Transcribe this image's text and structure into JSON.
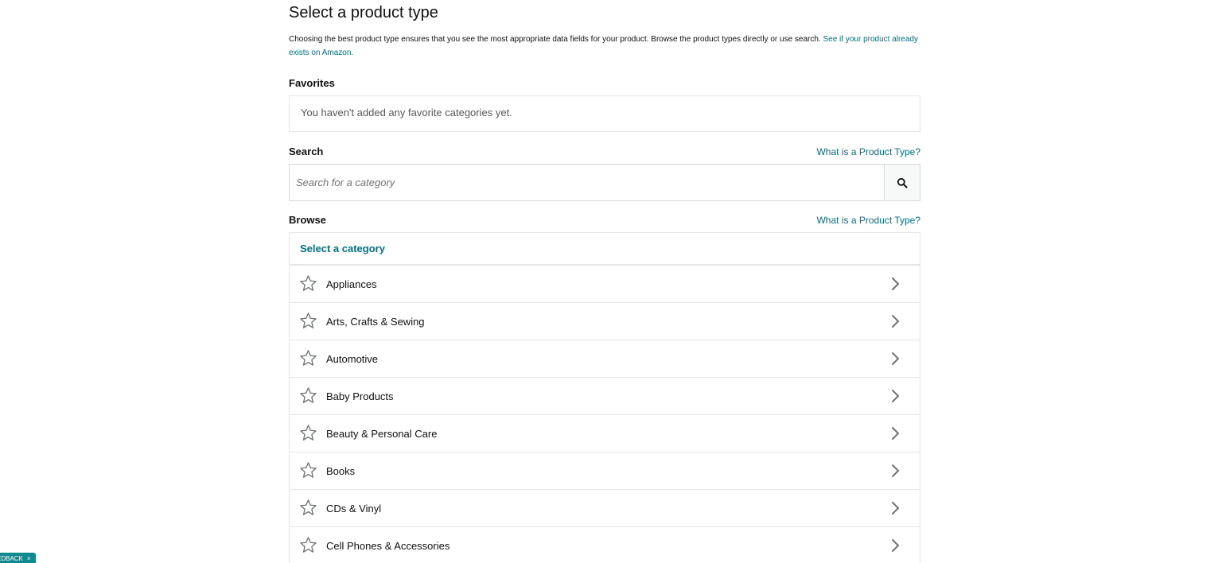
{
  "page": {
    "title": "Select a product type",
    "intro_text": "Choosing the best product type ensures that you see the most appropriate data fields for your product. Browse the product types directly or use search.",
    "intro_link": "See if your product already exists on Amazon."
  },
  "favorites": {
    "label": "Favorites",
    "empty_text": "You haven't added any favorite categories yet."
  },
  "search": {
    "label": "Search",
    "help_link": "What is a Product Type?",
    "placeholder": "Search for a category",
    "button_icon": "search-icon"
  },
  "browse": {
    "label": "Browse",
    "help_link": "What is a Product Type?",
    "header": "Select a category",
    "categories": [
      {
        "label": "Appliances",
        "icon": "star-outline-icon"
      },
      {
        "label": "Arts, Crafts & Sewing",
        "icon": "star-outline-icon"
      },
      {
        "label": "Automotive",
        "icon": "star-outline-icon"
      },
      {
        "label": "Baby Products",
        "icon": "star-outline-icon"
      },
      {
        "label": "Beauty & Personal Care",
        "icon": "star-outline-icon"
      },
      {
        "label": "Books",
        "icon": "star-outline-icon"
      },
      {
        "label": "CDs & Vinyl",
        "icon": "star-outline-icon"
      },
      {
        "label": "Cell Phones & Accessories",
        "icon": "star-outline-icon"
      }
    ]
  },
  "feedback": {
    "label": "EDBACK",
    "close": "×"
  },
  "colors": {
    "link": "#007185",
    "text": "#0f1111",
    "muted": "#565959",
    "border": "#e3e6e6",
    "icon_gray": "#6f7373",
    "feedback_bg": "#0f8a8f"
  }
}
